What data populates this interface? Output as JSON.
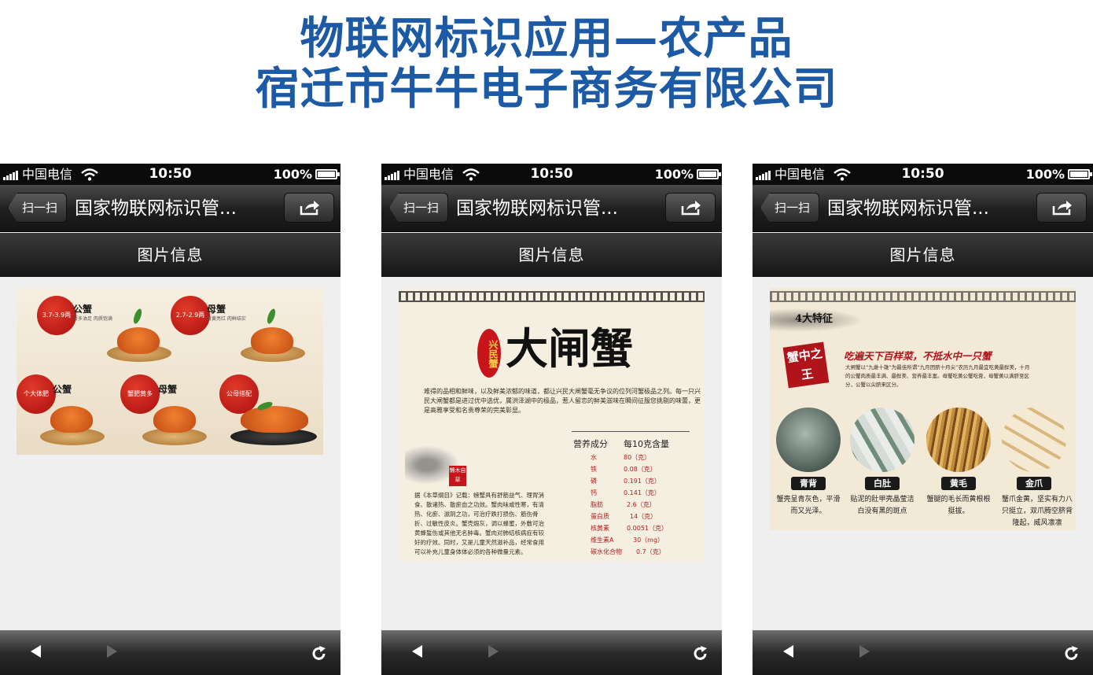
{
  "slide": {
    "title_line1": "物联网标识应用—农产品",
    "title_line2": "宿迁市牛牛电子商务有限公司",
    "title_color": "#1d5aa6"
  },
  "phone_ui": {
    "carrier": "中国电信",
    "time": "10:50",
    "battery": "100%",
    "back_label": "扫一扫",
    "nav_title": "国家物联网标识管...",
    "sub_header": "图片信息",
    "icons": [
      "signal-icon",
      "wifi-icon",
      "battery-icon",
      "share-icon",
      "back-arrow-icon",
      "forward-arrow-icon",
      "refresh-icon"
    ]
  },
  "poster1": {
    "items": [
      {
        "badge": "3.7-3.9两",
        "label": "公蟹",
        "sub": "膏多油足 肉质饱满"
      },
      {
        "badge": "2.7-2.9两",
        "label": "母蟹",
        "sub": "蟹黄亮红 肉鲜结实"
      },
      {
        "badge": "个大体肥",
        "label": "公蟹",
        "sub": ""
      },
      {
        "badge": "蟹肥黄多",
        "label": "母蟹",
        "sub": ""
      },
      {
        "badge": "公母搭配",
        "label": "",
        "sub": ""
      }
    ]
  },
  "poster2": {
    "seal": "兴民蟹",
    "brand": "大闸蟹",
    "intro": "难得的品相和鲜味，以及鲜美浓郁的味道，都让兴民大闸蟹毫无争议的位列河蟹极品之列。每一只兴民大闸蟹都是进过优中选优，属洪泽湖中的极品，惹人留恋的鲜美滋味在瞬间征服您挑剔的味蕾，更是高雅享受和名贵尊荣的完美彰显。",
    "stamp": "懒木自草",
    "body": "据《本草纲目》记载：螃蟹具有舒筋益气、理胃消食、散诸热、散瘀血之功效。蟹肉味咸性寒，有清热、化瘀、滋阴之功，可治疗跌打损伤、筋伤骨折、过敏性皮炎。蟹壳煅灰，调以蜂蜜，外敷可治黄蜂蜇伤或其他无名肿毒。蟹肉对肺结核病症有较好的疗效。同时，又是儿童天然滋补品，经常食用可以补充儿童身体体必须的各种微量元素。",
    "nutrition_header": [
      "营养成分",
      "每10克含量"
    ],
    "nutrition": [
      [
        "水",
        "80（克）"
      ],
      [
        "铁",
        "0.08（克）"
      ],
      [
        "磷",
        "0.191（克）"
      ],
      [
        "钙",
        "0.141（克）"
      ],
      [
        "脂肪",
        "2.6（克）"
      ],
      [
        "蛋白质",
        "14（克）"
      ],
      [
        "核黄素",
        "0.0051（克）"
      ],
      [
        "维生素A",
        "30（mg）"
      ],
      [
        "碳水化合物",
        "0.7（克）"
      ]
    ]
  },
  "poster3": {
    "heading": "4大特征",
    "slogan": "吃遍天下百样菜，不抵水中一只蟹",
    "seal": "蟹中之王",
    "intro": "大闸蟹以“九雌十雄”为最佳所谓“九月团脐十月尖”农历九月最宜吃黄最鲜美，十月的公蟹肉质最丰满、最鲜美、营养最丰富。母蟹吃黄公蟹吃膏，母蟹黄以满脐至区分，公蟹以尖脐来区分。",
    "features": [
      {
        "tag": "青背",
        "desc": "蟹壳呈青灰色，平滑而又光泽。"
      },
      {
        "tag": "白肚",
        "desc": "贴泥的肚甲壳晶莹洁白没有黑的斑点"
      },
      {
        "tag": "黄毛",
        "desc": "蟹腿的毛长而黄根根挺拔。"
      },
      {
        "tag": "金爪",
        "desc": "蟹爪金黄，坚实有力八只挺立，双爪腾空脐背隆起，威风凛凛"
      }
    ]
  }
}
